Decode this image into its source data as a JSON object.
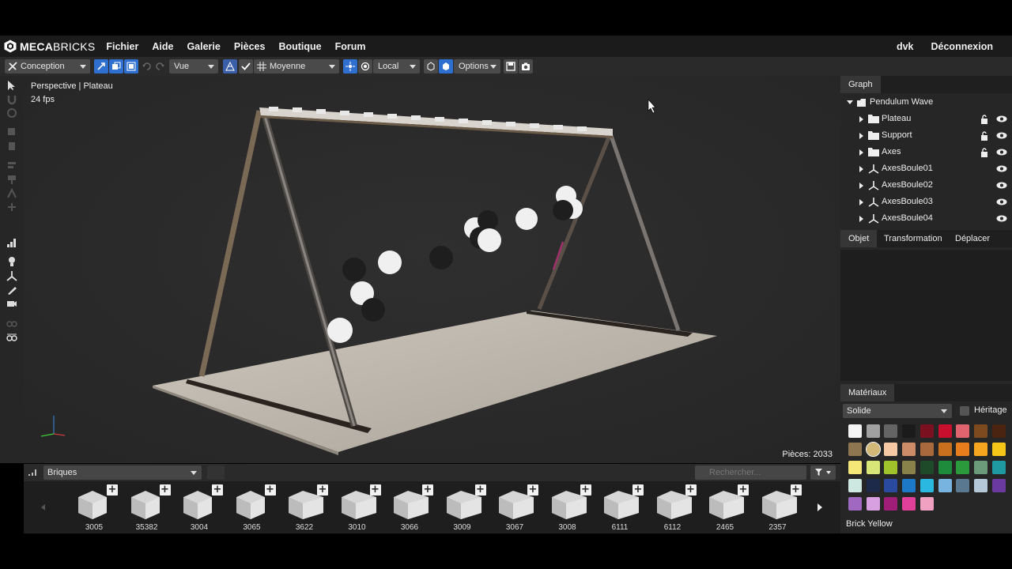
{
  "menubar": {
    "logo_text_bold": "MECA",
    "logo_text_rest": "BRICKS",
    "items": [
      {
        "label": "Fichier"
      },
      {
        "label": "Aide"
      },
      {
        "label": "Galerie"
      },
      {
        "label": "Pièces"
      },
      {
        "label": "Boutique"
      },
      {
        "label": "Forum"
      }
    ],
    "user": "dvk",
    "logout": "Déconnexion"
  },
  "toolbar": {
    "mode": "Conception",
    "view": "Vue",
    "grid": "Moyenne",
    "space": "Local",
    "options": "Options"
  },
  "viewport": {
    "label": "Perspective | Plateau",
    "fps": "24 fps",
    "pieces": "Pièces: 2033"
  },
  "brickbar": {
    "category": "Briques",
    "search_placeholder": "Rechercher...",
    "bricks": [
      {
        "id": "3005"
      },
      {
        "id": "35382"
      },
      {
        "id": "3004"
      },
      {
        "id": "3065"
      },
      {
        "id": "3622"
      },
      {
        "id": "3010"
      },
      {
        "id": "3066"
      },
      {
        "id": "3009"
      },
      {
        "id": "3067"
      },
      {
        "id": "3008"
      },
      {
        "id": "6111"
      },
      {
        "id": "6112"
      },
      {
        "id": "2465"
      },
      {
        "id": "2357"
      }
    ]
  },
  "graph": {
    "tab": "Graph",
    "root": "Pendulum Wave",
    "items": [
      {
        "label": "Plateau",
        "type": "folder",
        "lock": true
      },
      {
        "label": "Support",
        "type": "folder",
        "lock": true
      },
      {
        "label": "Axes",
        "type": "folder",
        "lock": true
      },
      {
        "label": "AxesBoule01",
        "type": "axes",
        "lock": false
      },
      {
        "label": "AxesBoule02",
        "type": "axes",
        "lock": false
      },
      {
        "label": "AxesBoule03",
        "type": "axes",
        "lock": false
      },
      {
        "label": "AxesBoule04",
        "type": "axes",
        "lock": false
      }
    ]
  },
  "properties": {
    "tabs": [
      {
        "label": "Objet"
      },
      {
        "label": "Transformation"
      },
      {
        "label": "Déplacer"
      }
    ]
  },
  "materials": {
    "tab": "Matériaux",
    "type": "Solide",
    "heritage": "Héritage",
    "selected": "Brick Yellow",
    "swatches": [
      "#f4f4f4",
      "#a0a0a0",
      "#646464",
      "#1b1b1b",
      "#7a1020",
      "#c8102e",
      "#e06470",
      "#7c4a1e",
      "#4a2410",
      "#8d7650",
      "#d4b878",
      "#f6c9a4",
      "#cc8c68",
      "#a86a3c",
      "#c8701e",
      "#e87d1e",
      "#f5a51e",
      "#f5c518",
      "#f5e678",
      "#d8e678",
      "#a0c22a",
      "#88824a",
      "#1e4a2a",
      "#1e8a3c",
      "#2a9a3c",
      "#6a9a7a",
      "#1e9aa0",
      "#cce8e0",
      "#1e2a4a",
      "#2a4aa0",
      "#1e78c8",
      "#2ab8e0",
      "#78b4e0",
      "#5a7890",
      "#b4c8d8",
      "#6a3aa0",
      "#a068c0",
      "#d8a0e0",
      "#a01e78",
      "#e0409a",
      "#f0a0c0"
    ]
  }
}
